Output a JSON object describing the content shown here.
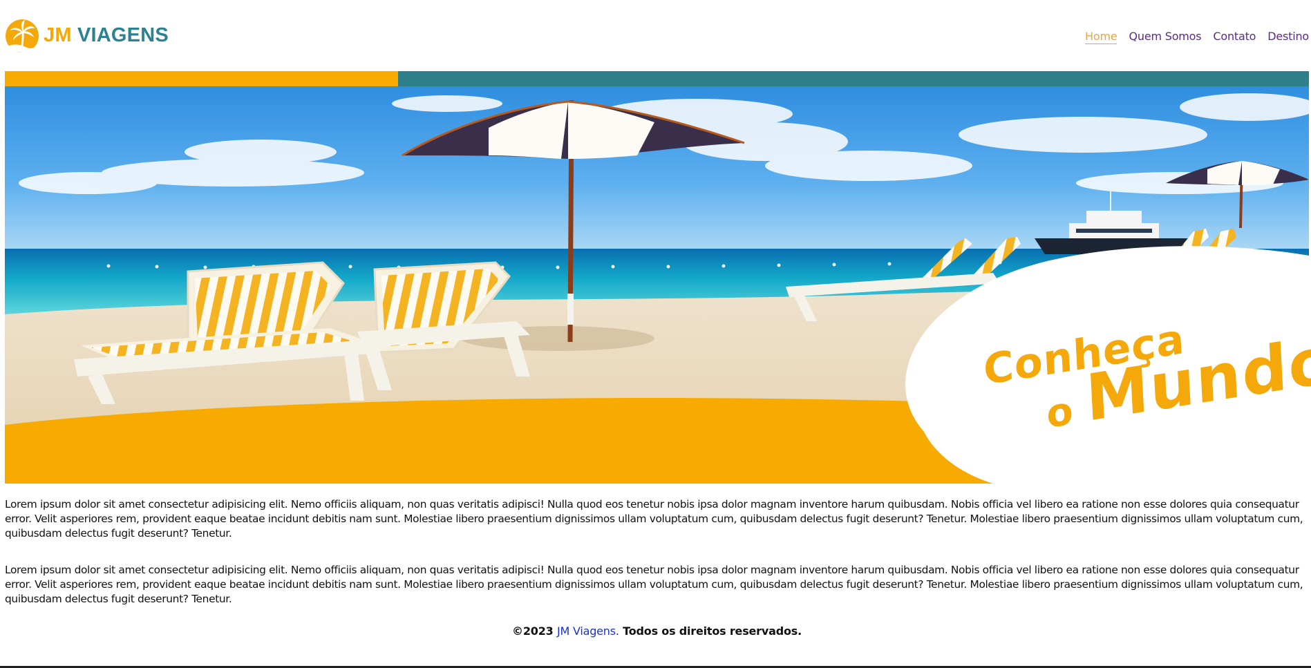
{
  "brand": {
    "part1": "JM",
    "part2": "VIAGENS",
    "colors": {
      "orange": "#f4a80a",
      "teal": "#2c8290"
    }
  },
  "nav": {
    "items": [
      {
        "label": "Home",
        "active": true
      },
      {
        "label": "Quem Somos",
        "active": false
      },
      {
        "label": "Contato",
        "active": false
      },
      {
        "label": "Destino",
        "active": false
      }
    ],
    "color": "#5b2a86",
    "active_color": "#e7a73e"
  },
  "hero": {
    "headline_line1": "Conheça",
    "headline_line2_small": "o",
    "headline_line2_big": "Mundo",
    "accent_orange": "#f7aa00",
    "accent_teal": "#2e7f8a"
  },
  "content": {
    "paragraphs": [
      "Lorem ipsum dolor sit amet consectetur adipisicing elit. Nemo officiis aliquam, non quas veritatis adipisci! Nulla quod eos tenetur nobis ipsa dolor magnam inventore harum quibusdam. Nobis officia vel libero ea ratione non esse dolores quia consequatur error. Velit asperiores rem, provident eaque beatae incidunt debitis nam sunt. Molestiae libero praesentium dignissimos ullam voluptatum cum, quibusdam delectus fugit deserunt? Tenetur. Molestiae libero praesentium dignissimos ullam voluptatum cum, quibusdam delectus fugit deserunt? Tenetur.",
      "Lorem ipsum dolor sit amet consectetur adipisicing elit. Nemo officiis aliquam, non quas veritatis adipisci! Nulla quod eos tenetur nobis ipsa dolor magnam inventore harum quibusdam. Nobis officia vel libero ea ratione non esse dolores quia consequatur error. Velit asperiores rem, provident eaque beatae incidunt debitis nam sunt. Molestiae libero praesentium dignissimos ullam voluptatum cum, quibusdam delectus fugit deserunt? Tenetur. Molestiae libero praesentium dignissimos ullam voluptatum cum, quibusdam delectus fugit deserunt? Tenetur."
    ]
  },
  "footer": {
    "copyright": "©2023",
    "brand": "JM Viagens.",
    "rights": "Todos os direitos reservados."
  }
}
